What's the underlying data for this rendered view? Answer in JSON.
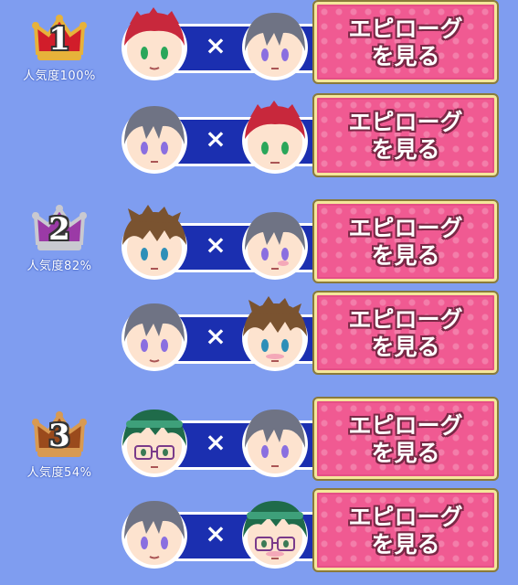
{
  "button_label_line1": "エピローグ",
  "button_label_line2": "を見る",
  "times_symbol": "×",
  "ranks": [
    {
      "number": "1",
      "popularity": "人気度100%",
      "crown_color": "#d11d2a",
      "crown_trim": "#e7b23a",
      "pairs": [
        {
          "left": "red-haired-character",
          "right": "gray-haired-character"
        },
        {
          "left": "gray-haired-character",
          "right": "red-haired-character"
        }
      ]
    },
    {
      "number": "2",
      "popularity": "人気度82%",
      "crown_color": "#9b3aa6",
      "crown_trim": "#c9c9d0",
      "pairs": [
        {
          "left": "brown-haired-character",
          "right": "gray-haired-character"
        },
        {
          "left": "gray-haired-character",
          "right": "brown-haired-character"
        }
      ]
    },
    {
      "number": "3",
      "popularity": "人気度54%",
      "crown_color": "#9a4a1c",
      "crown_trim": "#d89a52",
      "pairs": [
        {
          "left": "green-haired-glasses-character",
          "right": "gray-haired-character"
        },
        {
          "left": "gray-haired-character",
          "right": "green-haired-glasses-character"
        }
      ]
    }
  ],
  "character_colors": {
    "red-haired-character": {
      "hair": "#c8283c",
      "eye": "#2aa65a"
    },
    "gray-haired-character": {
      "hair": "#6f7384",
      "eye": "#8a6fe0"
    },
    "brown-haired-character": {
      "hair": "#7a5330",
      "eye": "#2e8fb8"
    },
    "green-haired-glasses-character": {
      "hair": "#1f6b4a",
      "eye": "#3b7a55"
    }
  }
}
